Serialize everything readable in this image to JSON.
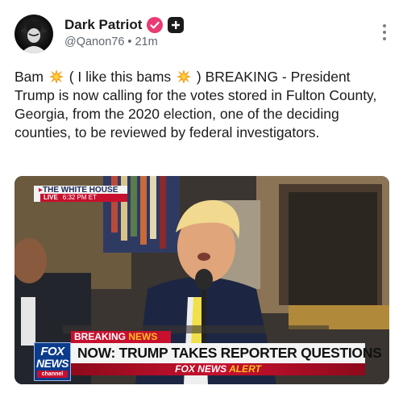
{
  "post": {
    "author": {
      "display_name": "Dark Patriot",
      "handle": "@Qanon76",
      "separator": "•",
      "time_ago": "21m",
      "verified_color": "#e83a73"
    },
    "text_parts": {
      "a": "Bam",
      "b": "( I like this bams",
      "c": ") BREAKING - President Trump is now calling for the votes stored in Fulton County, Georgia, from the 2020 election, one of the deciding counties, to be reviewed by federal investigators."
    },
    "icons": {
      "verified": "verified-badge-icon",
      "plus": "plus-badge-icon",
      "more": "more-vertical-icon",
      "boom": "collision-emoji-icon"
    }
  },
  "media": {
    "location_tag": "THE WHITE HOUSE",
    "live_label": "LIVE",
    "live_time": "6:32 PM ET",
    "breaking_label": "BREAKING",
    "breaking_news_word": "NEWS",
    "headline": "NOW: TRUMP TAKES REPORTER QUESTIONS",
    "alert_prefix": "FOX NEWS",
    "alert_word": "ALERT",
    "logo_fox": "FOX",
    "logo_news": "NEWS",
    "logo_channel": "channel",
    "colors": {
      "fox_red": "#c8102e",
      "fox_blue": "#0b3c8c",
      "alert_yellow": "#f5c11e"
    }
  }
}
